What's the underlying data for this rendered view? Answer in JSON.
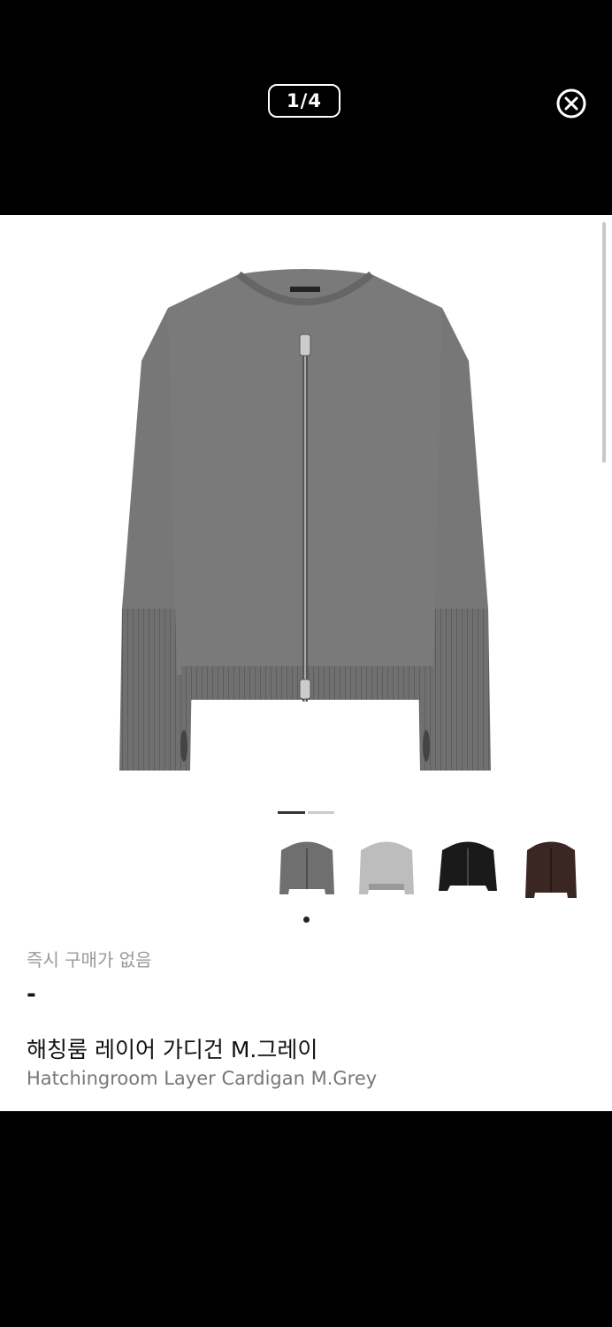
{
  "viewer": {
    "counter": "1/4",
    "close_icon": "close-circle-icon"
  },
  "gallery": {
    "current_index": 1,
    "total": 4,
    "image_icon": "cardigan-photo-grey"
  },
  "swatches": [
    {
      "name": "grey-cardigan-thumb",
      "color": "#6f6f6f",
      "selected": true
    },
    {
      "name": "lightgrey-sweater-thumb",
      "color": "#bdbdbd",
      "selected": false
    },
    {
      "name": "black-cardigan-thumb",
      "color": "#1a1a1a",
      "selected": false
    },
    {
      "name": "brown-cardigan-thumb",
      "color": "#3a2622",
      "selected": false
    }
  ],
  "product": {
    "status": "즉시 구매가 없음",
    "price": "-",
    "name_ko": "해칭룸 레이어 가디건 M.그레이",
    "name_en": "Hatchingroom Layer Cardigan M.Grey"
  },
  "colors": {
    "background": "#000000",
    "sheet": "#ffffff",
    "knit_grey": "#707070"
  }
}
